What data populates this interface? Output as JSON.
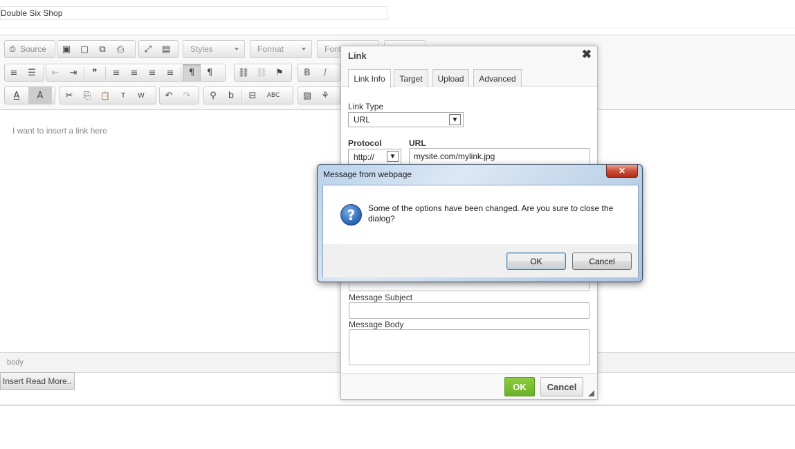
{
  "page": {
    "title_value": "Double Six Shop"
  },
  "toolbar": {
    "source_label": "Source",
    "styles_label": "Styles",
    "format_label": "Format",
    "font_label": "Font",
    "icons": {
      "source": "⎙",
      "save": "▣",
      "new_page": "▢",
      "preview": "⧉",
      "print": "⎙",
      "maximize": "⤢",
      "show_blocks": "▤",
      "numbered_list": "≡",
      "bulleted_list": "☰",
      "outdent": "⇤",
      "indent": "⇥",
      "blockquote": "❞",
      "align_left": "≡",
      "align_center": "≡",
      "align_right": "≡",
      "justify": "≡",
      "ltr": "¶",
      "rtl": "¶",
      "link": "⛓",
      "unlink": "⛓",
      "anchor": "⚑",
      "bold": "B",
      "italic": "I",
      "text_color": "A",
      "bg_color": "A",
      "cut": "✂",
      "copy": "⎘",
      "paste": "📋",
      "paste_text": "T",
      "paste_word": "W",
      "undo": "↶",
      "redo": "↷",
      "find": "⚲",
      "replace": "b",
      "select_all": "⊟",
      "spellcheck": "ABC",
      "image": "▨",
      "flash": "⚘"
    }
  },
  "editor": {
    "content_text": "I want to insert a link here",
    "path": "body"
  },
  "read_more_label": "Insert Read More..",
  "link_dialog": {
    "title": "Link",
    "close_symbol": "✖",
    "tabs": [
      "Link Info",
      "Target",
      "Upload",
      "Advanced"
    ],
    "link_type_label": "Link Type",
    "link_type_value": "URL",
    "protocol_label": "Protocol",
    "protocol_value": "http://",
    "url_label": "URL",
    "url_value": "mysite.com/mylink.jpg",
    "message_subject_label": "Message Subject",
    "message_body_label": "Message Body",
    "ok_label": "OK",
    "cancel_label": "Cancel"
  },
  "message_box": {
    "title": "Message from webpage",
    "close_symbol": "✕",
    "icon_glyph": "?",
    "message": "Some of the options have been changed. Are you sure to close the dialog?",
    "ok_label": "OK",
    "cancel_label": "Cancel"
  },
  "colors": {
    "dialog_ok_green": "#7cbf33",
    "msgbox_close_red": "#c9503b",
    "msgbox_frame": "#b9d1ea"
  }
}
